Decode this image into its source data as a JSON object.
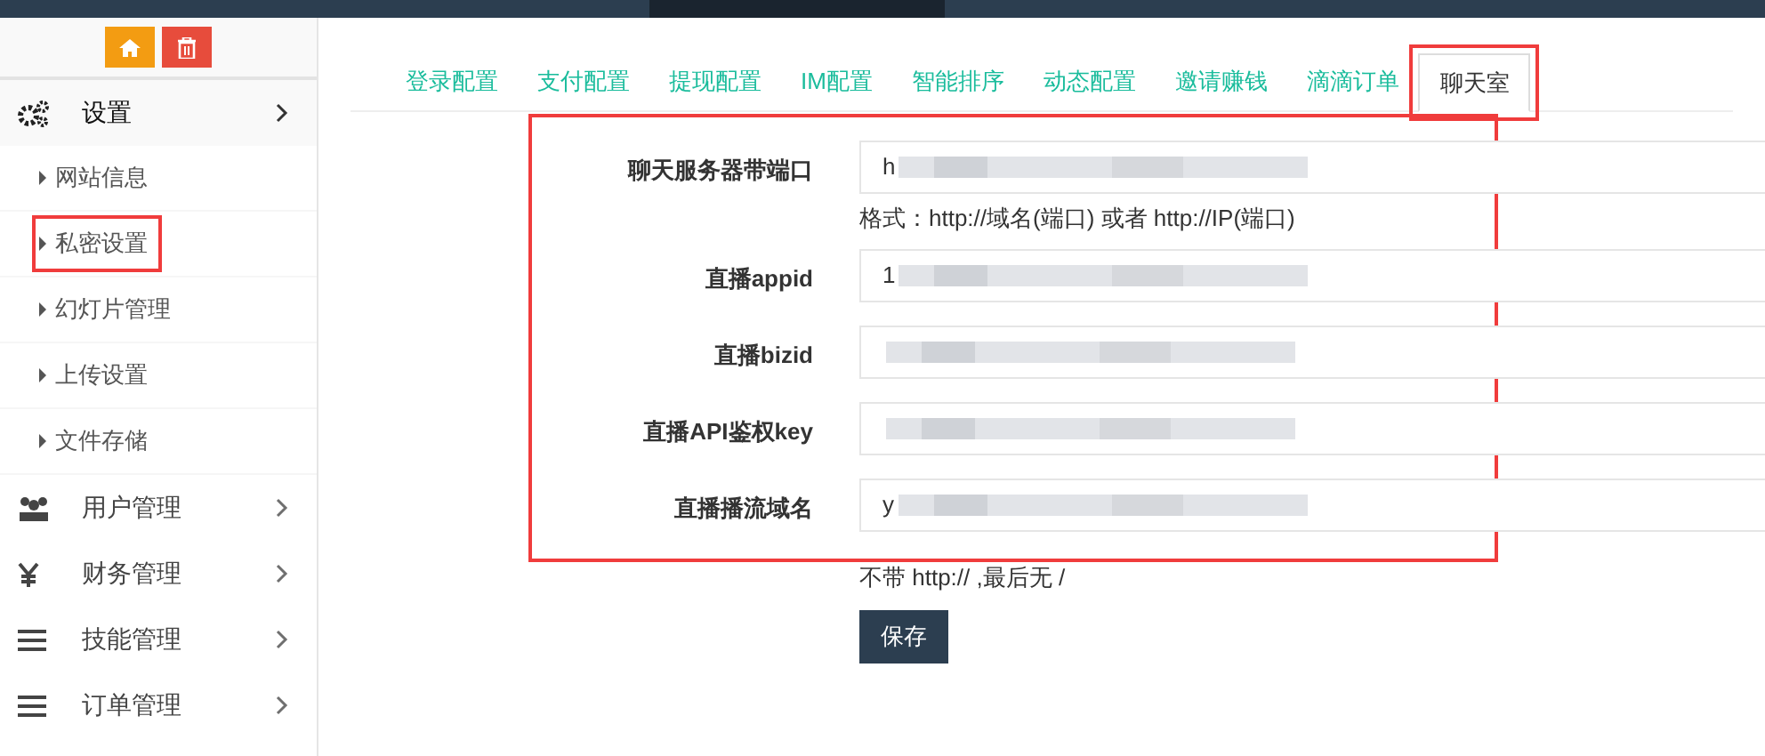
{
  "toolbar": {
    "buttons": [
      {
        "kind": "home",
        "color": "#f39c12"
      },
      {
        "kind": "delete",
        "color": "#e74c3c"
      }
    ]
  },
  "sidebar": {
    "items": [
      {
        "label": "设置",
        "kind": "gears",
        "expanded": true,
        "children": [
          {
            "label": "网站信息",
            "highlighted": false
          },
          {
            "label": "私密设置",
            "highlighted": true
          },
          {
            "label": "幻灯片管理",
            "highlighted": false
          },
          {
            "label": "上传设置",
            "highlighted": false
          },
          {
            "label": "文件存储",
            "highlighted": false
          }
        ]
      },
      {
        "label": "用户管理",
        "kind": "users",
        "expanded": false
      },
      {
        "label": "财务管理",
        "kind": "yen",
        "expanded": false
      },
      {
        "label": "技能管理",
        "kind": "bars",
        "expanded": false
      },
      {
        "label": "订单管理",
        "kind": "bars",
        "expanded": false
      }
    ]
  },
  "tabs": [
    {
      "label": "登录配置",
      "selected": false,
      "highlighted": false
    },
    {
      "label": "支付配置",
      "selected": false,
      "highlighted": false
    },
    {
      "label": "提现配置",
      "selected": false,
      "highlighted": false
    },
    {
      "label": "IM配置",
      "selected": false,
      "highlighted": false
    },
    {
      "label": "智能排序",
      "selected": false,
      "highlighted": false
    },
    {
      "label": "动态配置",
      "selected": false,
      "highlighted": false
    },
    {
      "label": "邀请赚钱",
      "selected": false,
      "highlighted": false
    },
    {
      "label": "滴滴订单",
      "selected": false,
      "highlighted": false
    },
    {
      "label": "聊天室",
      "selected": true,
      "highlighted": true
    }
  ],
  "form": {
    "highlighted": true,
    "fields": [
      {
        "label": "聊天服务器带端口",
        "value": "h",
        "hint": "格式：http://域名(端口) 或者 http://IP(端口)"
      },
      {
        "label": "直播appid",
        "value": "1"
      },
      {
        "label": "直播bizid"
      },
      {
        "label": "直播API鉴权key"
      },
      {
        "label": "直播播流域名",
        "value": "y"
      }
    ],
    "after_hint": "不带 http:// ,最后无 /",
    "submit": "保存"
  }
}
